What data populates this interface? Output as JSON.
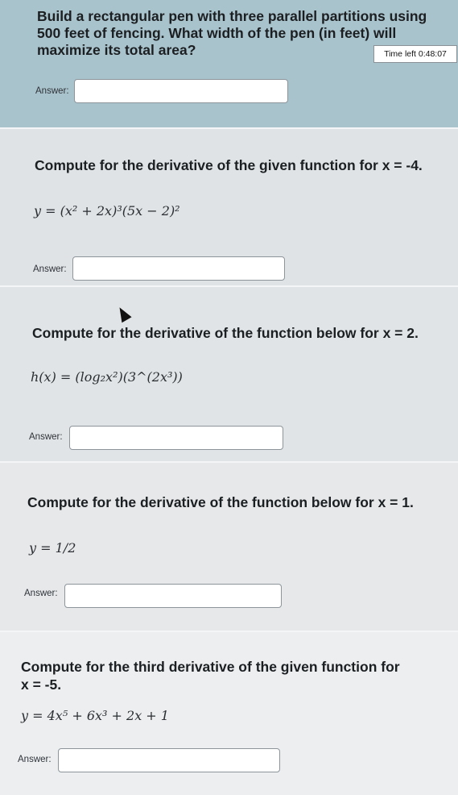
{
  "questions": [
    {
      "text": "Build a rectangular pen with three parallel partitions using 500 feet of fencing. What width of the pen (in feet) will maximize its total area?",
      "answer_label": "Answer:",
      "answer_value": ""
    },
    {
      "text": "Compute for the derivative of the given function for x = -4.",
      "formula": "y = (x² + 2x)³(5x − 2)²",
      "answer_label": "Answer:",
      "answer_value": ""
    },
    {
      "text": "Compute for the derivative of the function below for x = 2.",
      "formula": "h(x) = (log₂x²)(3^(2x³))",
      "answer_label": "Answer:",
      "answer_value": ""
    },
    {
      "text": "Compute for the derivative of the function below for x = 1.",
      "formula": "y = 1/2",
      "answer_label": "Answer:",
      "answer_value": ""
    },
    {
      "text": "Compute for the third derivative of the given function for x = -5.",
      "formula": "y = 4x⁵ + 6x³ + 2x + 1",
      "answer_label": "Answer:",
      "answer_value": ""
    }
  ],
  "timer": {
    "label": "Time left 0:48:07"
  },
  "colors": {
    "active_question_bg": "#a9c3cc",
    "question_bg": "#e1e4e6"
  }
}
